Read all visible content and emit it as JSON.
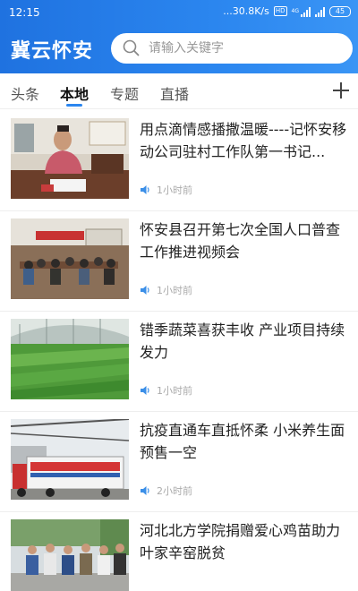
{
  "status_bar": {
    "time": "12:15",
    "speed": "...30.8K/s",
    "hd_badge": "HD",
    "network": "4G",
    "battery": "45"
  },
  "app": {
    "title": "冀云怀安"
  },
  "search": {
    "placeholder": "请输入关键字"
  },
  "tabs": [
    {
      "label": "头条",
      "active": false
    },
    {
      "label": "本地",
      "active": true
    },
    {
      "label": "专题",
      "active": false
    },
    {
      "label": "直播",
      "active": false
    }
  ],
  "news": [
    {
      "title": "用点滴情感播撒温暖----记怀安移动公司驻村工作队第一书记...",
      "time": "1小时前",
      "icon": "speaker-icon"
    },
    {
      "title": "怀安县召开第七次全国人口普查工作推进视频会",
      "time": "1小时前",
      "icon": "speaker-icon"
    },
    {
      "title": "错季蔬菜喜获丰收 产业项目持续发力",
      "time": "1小时前",
      "icon": "speaker-icon"
    },
    {
      "title": "抗疫直通车直抵怀柔 小米养生面预售一空",
      "time": "2小时前",
      "icon": "speaker-icon"
    },
    {
      "title": "河北北方学院捐赠爱心鸡苗助力叶家辛窑脱贫",
      "time": "",
      "icon": "speaker-icon"
    }
  ],
  "colors": {
    "header_blue": "#2b86ef",
    "accent": "#2b86ef"
  }
}
